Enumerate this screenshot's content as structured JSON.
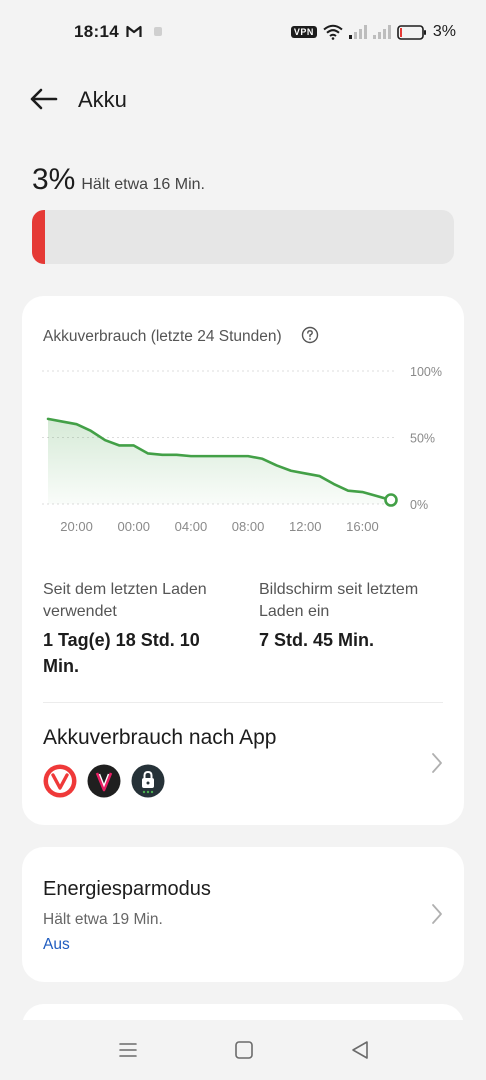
{
  "status_bar": {
    "time": "18:14",
    "vpn": "VPN",
    "battery_percent": "3%",
    "icons": [
      "gmail-icon",
      "notification-icon",
      "vpn-icon",
      "wifi-icon",
      "signal-icon",
      "signal-icon",
      "battery-icon"
    ]
  },
  "header": {
    "title": "Akku",
    "back_icon": "back-arrow-icon"
  },
  "battery": {
    "level": "3%",
    "estimate": "Hält etwa 16 Min.",
    "fill_percent": 3,
    "fill_color": "#e53935"
  },
  "usage_card": {
    "title": "Akkuverbrauch (letzte 24 Stunden)",
    "help_icon": "help-circle-icon",
    "stats": {
      "since_charge_label": "Seit dem letzten Laden verwendet",
      "since_charge_value": "1 Tag(e) 18 Std. 10 Min.",
      "screen_label": "Bildschirm seit letztem Laden ein",
      "screen_value": "7 Std. 45 Min."
    },
    "app_usage": {
      "title": "Akkuverbrauch nach App",
      "apps": [
        "vivaldi-icon",
        "vanadium-icon",
        "lock-app-icon"
      ]
    }
  },
  "chart_data": {
    "type": "area",
    "x": [
      "18:00",
      "19:00",
      "20:00",
      "21:00",
      "22:00",
      "23:00",
      "00:00",
      "01:00",
      "02:00",
      "03:00",
      "04:00",
      "05:00",
      "06:00",
      "07:00",
      "08:00",
      "09:00",
      "10:00",
      "11:00",
      "12:00",
      "13:00",
      "14:00",
      "15:00",
      "16:00",
      "17:00",
      "18:00"
    ],
    "series": [
      {
        "values": [
          64,
          62,
          60,
          55,
          48,
          44,
          44,
          38,
          37,
          37,
          36,
          36,
          36,
          36,
          36,
          34,
          29,
          25,
          23,
          21,
          15,
          10,
          9,
          6,
          3
        ]
      }
    ],
    "xtick_labels": [
      "20:00",
      "00:00",
      "04:00",
      "08:00",
      "12:00",
      "16:00"
    ],
    "ytick_labels": [
      "100%",
      "50%",
      "0%"
    ],
    "ylim": [
      0,
      100
    ],
    "grid": true,
    "line_color": "#43a047"
  },
  "energy_card": {
    "title": "Energiesparmodus",
    "estimate": "Hält etwa 19 Min.",
    "status": "Aus"
  },
  "nav_bar": {
    "icons": [
      "menu-icon",
      "home-icon",
      "back-icon"
    ]
  }
}
